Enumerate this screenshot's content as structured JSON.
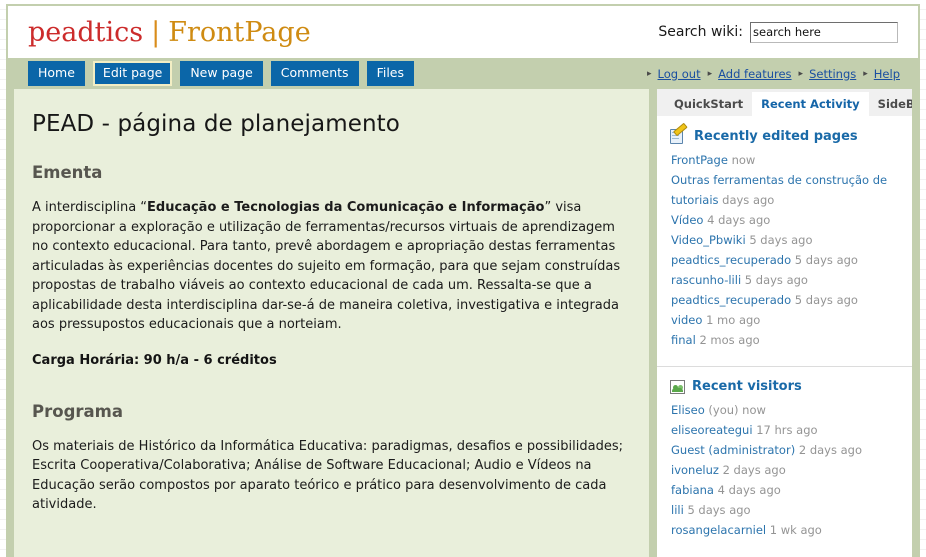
{
  "header": {
    "site_name": "peadtics",
    "separator": "|",
    "page_name": "FrontPage",
    "search_label": "Search wiki:",
    "search_value": "search here",
    "search_placeholder": "search here"
  },
  "nav": {
    "tabs": [
      {
        "label": "Home",
        "active": false
      },
      {
        "label": "Edit page",
        "active": true
      },
      {
        "label": "New page",
        "active": false
      },
      {
        "label": "Comments",
        "active": false
      },
      {
        "label": "Files",
        "active": false
      }
    ],
    "util_links": [
      {
        "label": "Log out"
      },
      {
        "label": "Add features"
      },
      {
        "label": "Settings"
      },
      {
        "label": "Help"
      }
    ],
    "bullet": "▸"
  },
  "content": {
    "title": "PEAD - página de planejamento",
    "sections": [
      {
        "heading": "Ementa",
        "paragraph_pre": "A interdisciplina “",
        "paragraph_bold": "Educação e Tecnologias da Comunicação e Informação",
        "paragraph_post": "” visa proporcionar a exploração e utilização de ferramentas/recursos virtuais de aprendizagem no contexto educacional. Para tanto, prevê abordagem e apropriação destas ferramentas articuladas às experiências docentes do sujeito em formação, para que sejam construídas propostas de trabalho viáveis ao contexto educacional de cada um. Ressalta-se que a aplicabilidade desta interdisciplina dar-se-á de maneira coletiva, investigativa e integrada aos pressupostos educacionais que a norteiam.",
        "note": "Carga Horária: 90 h/a  -  6 créditos"
      },
      {
        "heading": "Programa",
        "paragraph": "Os materiais de Histórico da Informática Educativa: paradigmas, desafios e possibilidades; Escrita Cooperativa/Colaborativa; Análise de Software Educacional; Audio e Vídeos na Educação serão compostos por aparato teórico e prático para desenvolvimento de cada atividade."
      }
    ]
  },
  "sidebar": {
    "tabs": [
      {
        "label": "QuickStart",
        "active": false
      },
      {
        "label": "Recent Activity",
        "active": true
      },
      {
        "label": "SideBar",
        "active": false
      }
    ],
    "recent_pages": {
      "icon": "page-edit-icon",
      "title": "Recently edited pages",
      "items": [
        {
          "name": "FrontPage",
          "ago": "now"
        },
        {
          "name": "Outras ferramentas de construção de tutoriais",
          "ago": "days ago"
        },
        {
          "name": "Vídeo",
          "ago": "4 days ago"
        },
        {
          "name": "Video_Pbwiki",
          "ago": "5 days ago"
        },
        {
          "name": "peadtics_recuperado",
          "ago": "5 days ago"
        },
        {
          "name": "rascunho-lili",
          "ago": "5 days ago"
        },
        {
          "name": "peadtics_recuperado",
          "ago": "5 days ago"
        },
        {
          "name": "video",
          "ago": "1 mo ago"
        },
        {
          "name": "final",
          "ago": "2 mos ago"
        }
      ]
    },
    "recent_visitors": {
      "icon": "people-icon",
      "title": "Recent visitors",
      "items": [
        {
          "name": "Eliseo",
          "ago": "(you) now"
        },
        {
          "name": "eliseoreategui",
          "ago": "17 hrs ago"
        },
        {
          "name": "Guest (administrator)",
          "ago": "2 days ago"
        },
        {
          "name": "ivoneluz",
          "ago": "2 days ago"
        },
        {
          "name": "fabiana",
          "ago": "4 days ago"
        },
        {
          "name": "lili",
          "ago": "5 days ago"
        },
        {
          "name": "rosangelacarniel",
          "ago": "1 wk ago"
        }
      ]
    }
  },
  "colors": {
    "frame": "#c3cfae",
    "content_bg": "#e9efdb",
    "nav_button": "#0b66a8",
    "nav_active_border": "#f2eec4",
    "site_name": "#cc2b2b",
    "page_name": "#cf8b12",
    "link": "#2c74ad",
    "heading": "#57564f"
  }
}
